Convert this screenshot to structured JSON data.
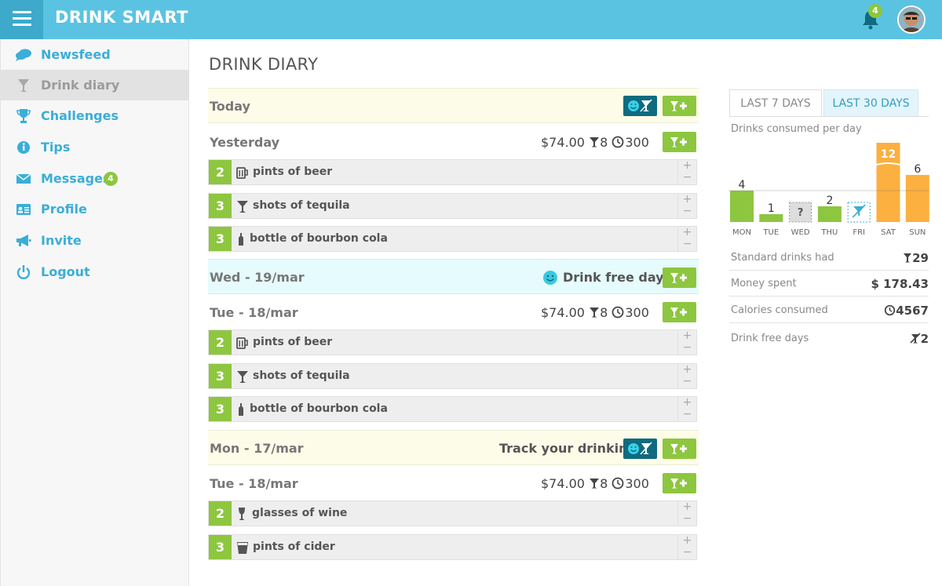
{
  "app": {
    "title": "DRINK SMART",
    "notification_count": "4"
  },
  "sidebar": {
    "items": [
      {
        "label": "Newsfeed",
        "icon": "chat-bubbles-icon"
      },
      {
        "label": "Drink diary",
        "icon": "cocktail-glass-icon",
        "active": true
      },
      {
        "label": "Challenges",
        "icon": "trophy-icon"
      },
      {
        "label": "Tips",
        "icon": "info-icon"
      },
      {
        "label": "Messages",
        "icon": "envelope-icon",
        "badge": "4"
      },
      {
        "label": "Profile",
        "icon": "id-card-icon"
      },
      {
        "label": "Invite",
        "icon": "megaphone-icon"
      },
      {
        "label": "Logout",
        "icon": "power-icon"
      }
    ]
  },
  "main": {
    "title": "DRINK DIARY",
    "days": [
      {
        "title": "Today",
        "type": "track"
      },
      {
        "title": "Yesterday",
        "money": "$74.00",
        "drinks": "8",
        "calories": "300",
        "entries": [
          {
            "qty": "2",
            "label": "pints of beer",
            "icon": "beer-mug-icon"
          },
          {
            "qty": "3",
            "label": "shots of tequila",
            "icon": "cocktail-glass-icon"
          },
          {
            "qty": "3",
            "label": "bottle of bourbon cola",
            "icon": "bottle-icon"
          }
        ]
      },
      {
        "title": "Wed - 19/mar",
        "type": "free",
        "note": "Drink free day"
      },
      {
        "title": "Tue - 18/mar",
        "money": "$74.00",
        "drinks": "8",
        "calories": "300",
        "entries": [
          {
            "qty": "2",
            "label": "pints of beer",
            "icon": "beer-mug-icon"
          },
          {
            "qty": "3",
            "label": "shots of tequila",
            "icon": "cocktail-glass-icon"
          },
          {
            "qty": "3",
            "label": "bottle of bourbon cola",
            "icon": "bottle-icon"
          }
        ]
      },
      {
        "title": "Mon - 17/mar",
        "type": "track",
        "note": "Track your drinking"
      },
      {
        "title": "Tue - 18/mar",
        "money": "$74.00",
        "drinks": "8",
        "calories": "300",
        "entries": [
          {
            "qty": "2",
            "label": "glasses of wine",
            "icon": "wine-glass-icon"
          },
          {
            "qty": "3",
            "label": "pints of cider",
            "icon": "cider-glass-icon"
          }
        ]
      }
    ],
    "stepper": {
      "plus": "+",
      "minus": "−"
    }
  },
  "stats": {
    "tabs": [
      "LAST 7 DAYS",
      "LAST 30 DAYS"
    ],
    "active_tab": "LAST 30 DAYS",
    "summary": [
      {
        "label": "Standard drinks had",
        "value": "29",
        "icon": "cocktail-glass-icon"
      },
      {
        "label": "Money spent",
        "value": "$ 178.43"
      },
      {
        "label": "Calories consumed",
        "value": "4567",
        "icon": "calories-icon"
      },
      {
        "label": "Drink free days",
        "value": "2",
        "icon": "drink-free-icon"
      }
    ]
  },
  "chart_data": {
    "type": "bar",
    "title": "Drinks consumed per day",
    "categories": [
      "MON",
      "TUE",
      "WED",
      "THU",
      "FRI",
      "SAT",
      "SUN"
    ],
    "values": [
      4,
      1,
      null,
      2,
      0,
      12,
      6
    ],
    "value_labels": [
      "4",
      "1",
      "?",
      "2",
      "",
      "12",
      "6"
    ],
    "day_status": [
      "logged",
      "logged",
      "unknown",
      "logged",
      "drink-free",
      "over-limit",
      "over-limit"
    ],
    "limit": 4,
    "colors": {
      "normal": "#8dc63f",
      "over": "#fbb040",
      "unknown": "#dddddd",
      "free": "#3aaed8"
    }
  },
  "colors": {
    "accent": "#5bc3e2",
    "green": "#8dc63f",
    "dark_teal": "#0e6b80",
    "today_bg": "#fdfce8",
    "free_bg": "#e6fbfd"
  }
}
